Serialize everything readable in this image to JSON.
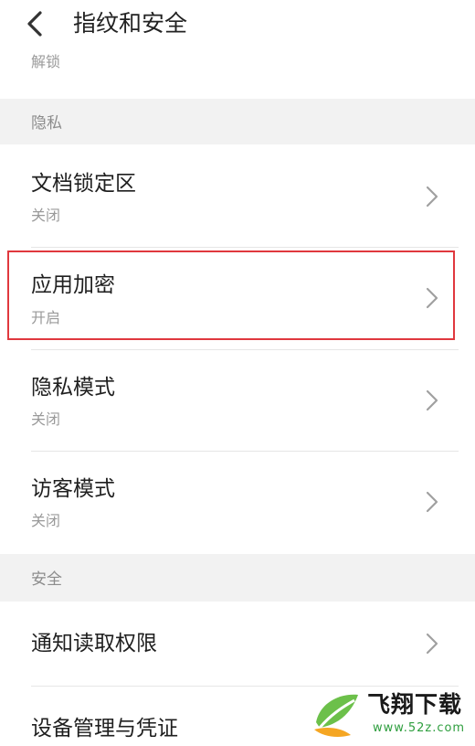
{
  "header": {
    "title": "指纹和安全",
    "back_icon": "chevron-left-icon"
  },
  "partial_row": {
    "subtitle": "解锁"
  },
  "sections": {
    "privacy": {
      "label": "隐私",
      "items": [
        {
          "title": "文档锁定区",
          "status": "关闭"
        },
        {
          "title": "应用加密",
          "status": "开启"
        },
        {
          "title": "隐私模式",
          "status": "关闭"
        },
        {
          "title": "访客模式",
          "status": "关闭"
        }
      ]
    },
    "security": {
      "label": "安全",
      "items": [
        {
          "title": "通知读取权限"
        },
        {
          "title": "设备管理与凭证"
        }
      ]
    }
  },
  "watermark": {
    "brand": "飞翔下载",
    "url": "www.52z.com"
  },
  "colors": {
    "highlight_border": "#e0383e",
    "section_background": "#f2f2f2",
    "secondary_text": "#9a9a9a",
    "watermark_green": "#2e9e3e"
  }
}
